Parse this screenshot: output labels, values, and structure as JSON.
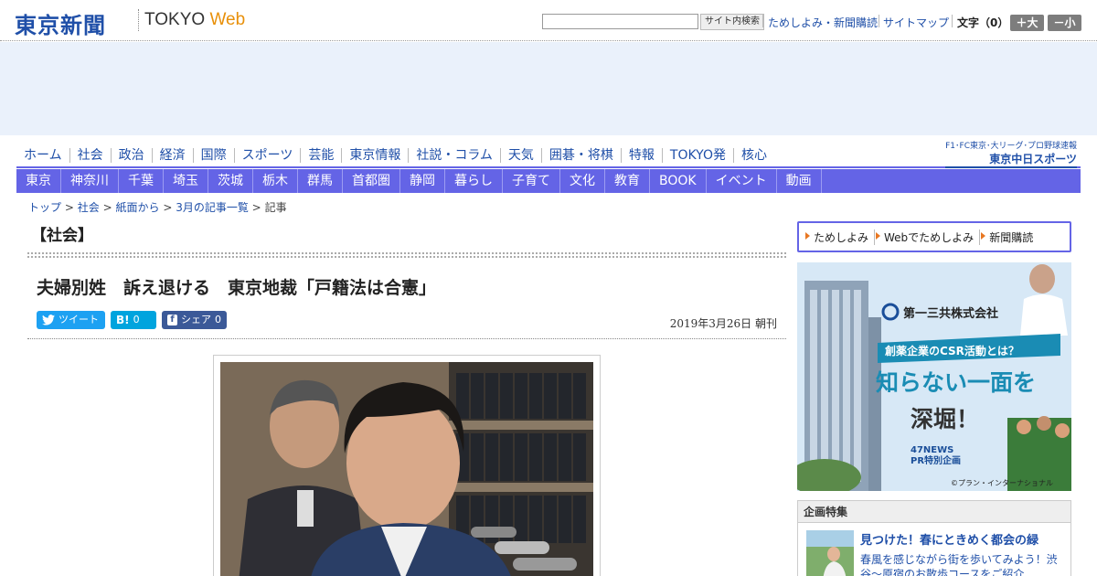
{
  "header": {
    "logo_jp": "東京新聞",
    "logo_en": "TOKYO",
    "logo_web": "Web",
    "search_placeholder": "",
    "search_button": "サイト内検索",
    "links": [
      "ためしよみ・新聞購読",
      "サイトマップ"
    ],
    "font_size_label": "文字（0）",
    "size_up": "＋大",
    "size_down": "－小"
  },
  "nav_main": {
    "items": [
      "ホーム",
      "社会",
      "政治",
      "経済",
      "国際",
      "スポーツ",
      "芸能",
      "東京情報",
      "社説・コラム",
      "天気",
      "囲碁・将棋",
      "特報",
      "TOKYO発",
      "核心"
    ],
    "brand_small": "F1･FC東京･大リーグ･プロ野球速報",
    "brand_big": "東京中日スポーツ"
  },
  "nav_sub": {
    "items": [
      "東京",
      "神奈川",
      "千葉",
      "埼玉",
      "茨城",
      "栃木",
      "群馬",
      "首都圏",
      "静岡",
      "暮らし",
      "子育て",
      "文化",
      "教育",
      "BOOK",
      "イベント",
      "動画"
    ]
  },
  "breadcrumb": {
    "items": [
      "トップ",
      "社会",
      "紙面から",
      "3月の記事一覧"
    ],
    "current": "記事",
    "sep": ">"
  },
  "article": {
    "section": "【社会】",
    "headline": "夫婦別姓　訴え退ける　東京地裁「戸籍法は合憲」",
    "share_twitter": "ツイート",
    "share_hatena_icon": "B!",
    "share_hatena_count": "0",
    "share_facebook": "シェア",
    "share_facebook_count": "0",
    "date": "2019年3月26日 朝刊"
  },
  "sidebar": {
    "links": [
      "ためしよみ",
      "Webでためしよみ",
      "新聞購読"
    ],
    "ad": {
      "company": "第一三共株式会社",
      "tagline": "創薬企業のCSR活動とは？",
      "headline1": "知らない一面を",
      "headline2": "深堀！",
      "badge1": "47NEWS",
      "badge2": "PR特別企画",
      "credit": "©プラン・インターナショナル"
    },
    "feature": {
      "heading": "企画特集",
      "title": "見つけた！春にときめく都会の緑",
      "desc": "春風を感じながら街を歩いてみよう！渋谷～原宿のお散歩コースをご紹介"
    }
  },
  "colors": {
    "nav_bar": "#6464e6",
    "link": "#1f4fa8",
    "ad_band": "#eaf1fb",
    "twitter": "#1da1f2",
    "hatena": "#00a4de",
    "facebook": "#3b5998"
  }
}
